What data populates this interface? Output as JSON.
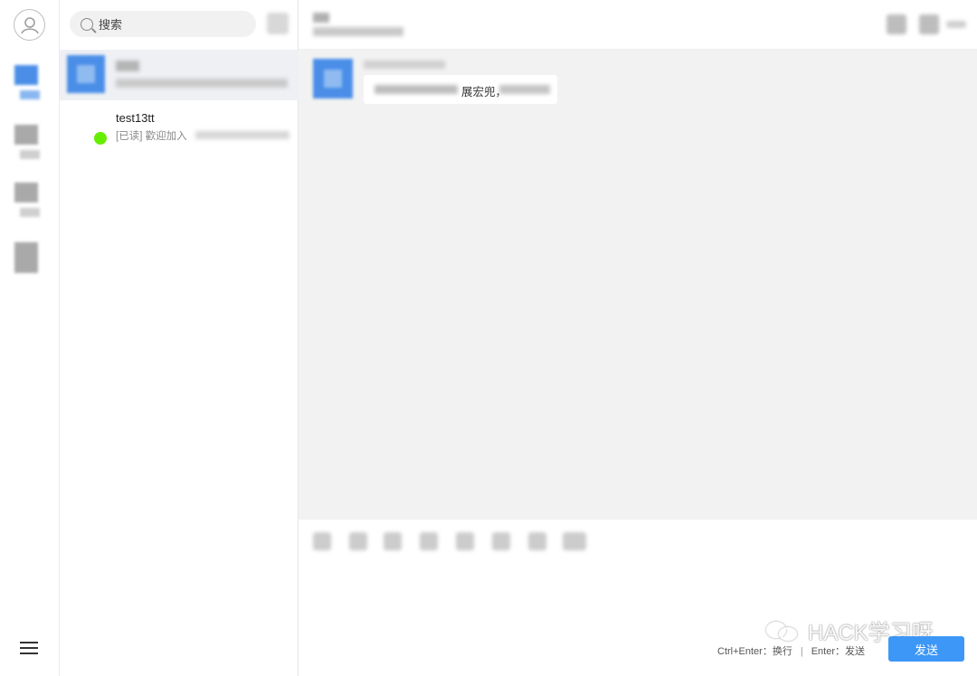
{
  "search": {
    "placeholder": "搜索"
  },
  "conversations": [
    {
      "name": "",
      "selected": true
    },
    {
      "name": "test13tt",
      "status": "online",
      "preview_read": "[已读]",
      "preview_text": "歡迎加入"
    }
  ],
  "chat": {
    "message_fragment": "展宏兜，"
  },
  "composer": {
    "hint_newline": "Ctrl+Enter：换行",
    "hint_separator": "|",
    "hint_send": "Enter：发送",
    "send_label": "发送"
  },
  "watermark": {
    "text": "HACK学习呀"
  },
  "colors": {
    "accent": "#3d97f7",
    "online": "#66ee00",
    "avatar_blue": "#4a8ee8"
  },
  "icons": {
    "rail": [
      "chat-icon",
      "contacts-icon",
      "groups-icon",
      "apps-icon"
    ],
    "composer": [
      "emoji-icon",
      "image-icon",
      "file-icon",
      "screenshot-icon",
      "folder-icon",
      "cut-icon",
      "voice-icon",
      "video-icon"
    ]
  }
}
